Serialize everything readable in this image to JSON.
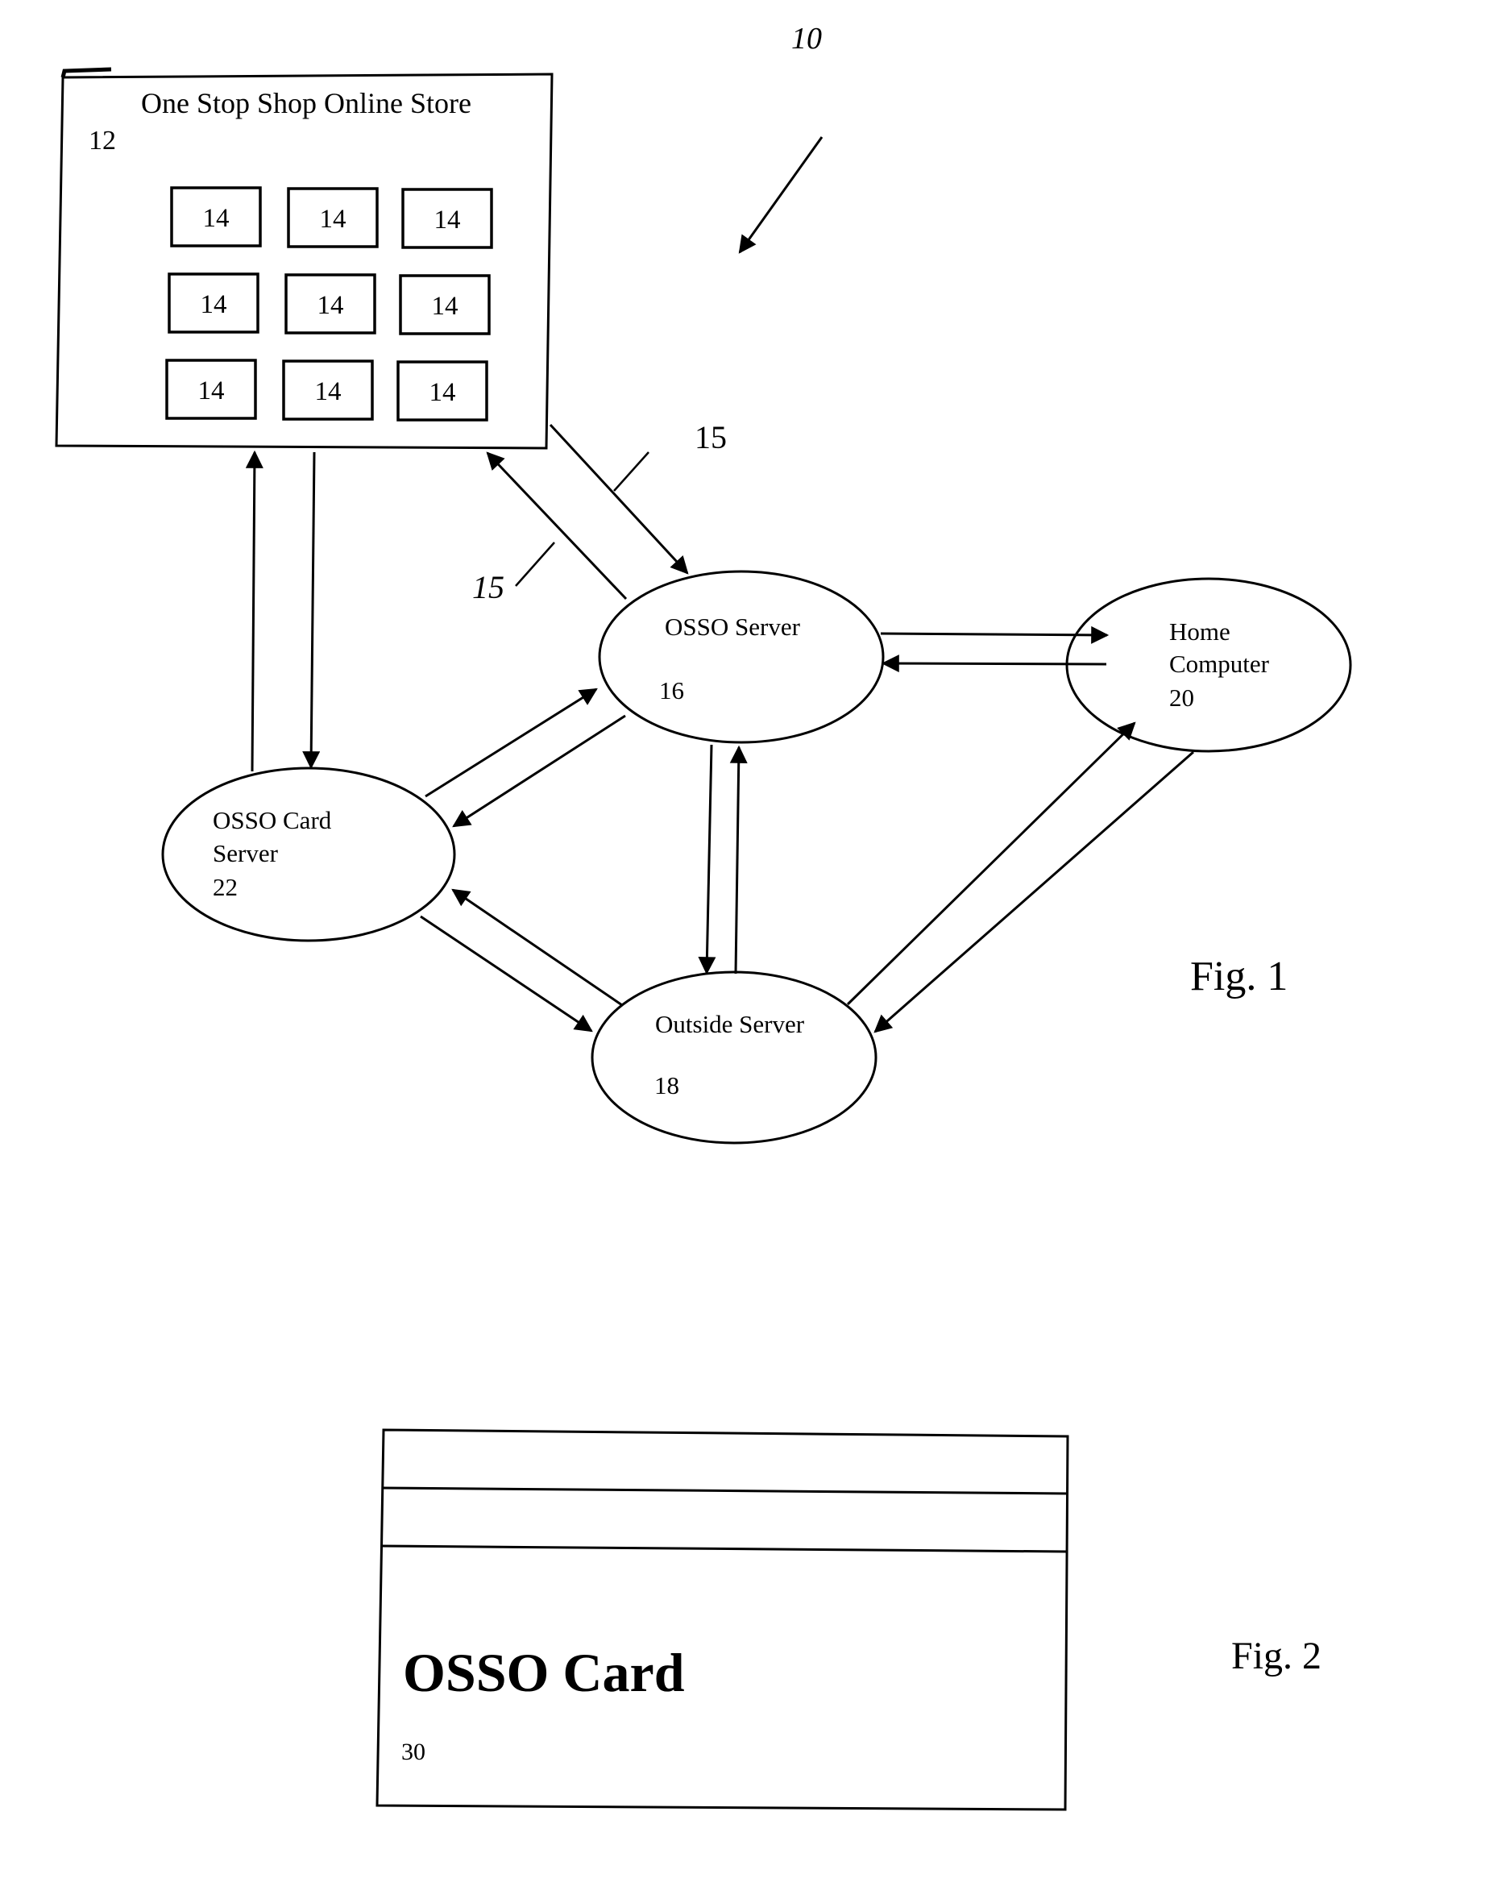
{
  "figure1": {
    "reference_label": "10",
    "caption": "Fig. 1",
    "store": {
      "title": "One Stop Shop Online Store",
      "number": "12",
      "items": [
        "14",
        "14",
        "14",
        "14",
        "14",
        "14",
        "14",
        "14",
        "14"
      ]
    },
    "link_labels": [
      "15",
      "15"
    ],
    "nodes": {
      "osso_server": {
        "lines": [
          "OSSO Server"
        ],
        "number": "16"
      },
      "home_computer": {
        "lines": [
          "Home",
          "Computer"
        ],
        "number": "20"
      },
      "osso_card_server": {
        "lines": [
          "OSSO Card",
          "Server"
        ],
        "number": "22"
      },
      "outside_server": {
        "lines": [
          "Outside Server"
        ],
        "number": "18"
      }
    }
  },
  "figure2": {
    "caption": "Fig. 2",
    "card": {
      "title": "OSSO Card",
      "number": "30"
    }
  },
  "colors": {
    "ink": "#000000",
    "paper": "#ffffff"
  }
}
